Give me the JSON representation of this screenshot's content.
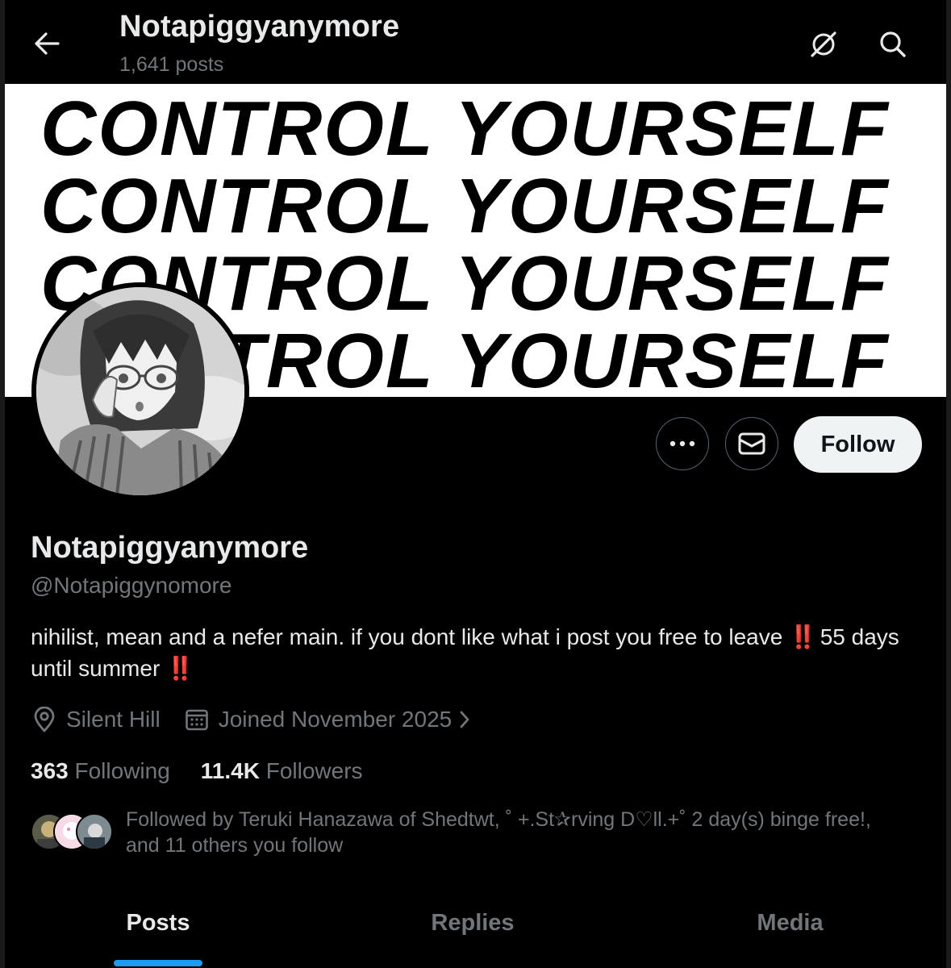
{
  "header": {
    "title": "Notapiggyanymore",
    "post_count": "1,641 posts"
  },
  "banner": {
    "lines": [
      "CONTROL YOURSELF",
      "CONTROL YOURSELF",
      "CONTROL YOURSELF",
      "CONTROL YOURSELF"
    ]
  },
  "actions": {
    "follow_label": "Follow"
  },
  "profile": {
    "display_name": "Notapiggyanymore",
    "handle": "@Notapiggynomore",
    "bio_part1": "nihilist, mean and a nefer main. if you dont like what i post you free to leave ",
    "bio_bang1": "‼️",
    "bio_part2": " 55 days until summer ",
    "bio_bang2": "‼️",
    "location": "Silent Hill",
    "joined": "Joined November 2025"
  },
  "stats": {
    "following_count": "363",
    "following_label": "Following",
    "followers_count": "11.4K",
    "followers_label": "Followers"
  },
  "followed_by": {
    "text_line1": "Followed by Teruki Hanazawa of Shedtwt, ˚ +.St✰rving D♡ll.+˚ 2 day(s) binge free!,",
    "text_line2": "and 11 others you follow"
  },
  "tabs": [
    {
      "label": "Posts",
      "active": true
    },
    {
      "label": "Replies",
      "active": false
    },
    {
      "label": "Media",
      "active": false
    }
  ],
  "colors": {
    "background": "#000000",
    "text_primary": "#e7e9ea",
    "text_secondary": "#71767b",
    "accent": "#1d9bf0",
    "alert_red": "#f4212e",
    "follow_button_bg": "#eff3f4"
  }
}
